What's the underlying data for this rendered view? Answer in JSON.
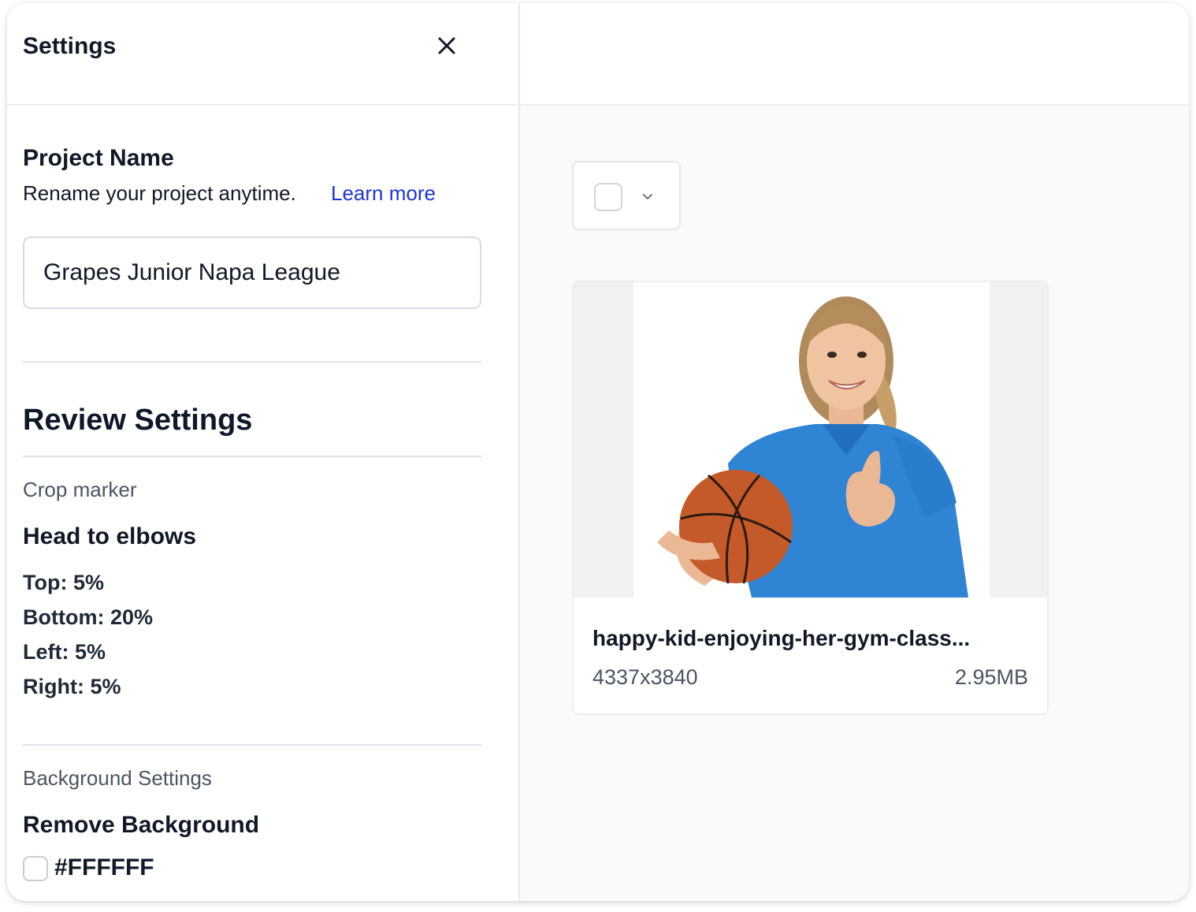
{
  "settings_panel": {
    "title": "Settings",
    "close_icon": "close-icon",
    "project_name": {
      "heading": "Project Name",
      "description": "Rename your project anytime.",
      "learn_more_label": "Learn more",
      "value": "Grapes Junior Napa League"
    },
    "review_settings": {
      "heading": "Review Settings",
      "crop_marker": {
        "caption": "Crop marker",
        "title": "Head to elbows",
        "lines": [
          "Top: 5%",
          "Bottom: 20%",
          "Left: 5%",
          "Right: 5%"
        ]
      },
      "background": {
        "caption": "Background Settings",
        "title": "Remove Background",
        "color_value": "#FFFFFF",
        "checked": false
      }
    }
  },
  "main": {
    "select_all": {
      "checked": false,
      "icon": "chevron-down-icon"
    },
    "files": [
      {
        "name": "happy-kid-enjoying-her-gym-class...",
        "dimensions": "4337x3840",
        "size": "2.95MB",
        "thumbnail": "girl-with-basketball-photo"
      }
    ]
  },
  "colors": {
    "link": "#1d35d6",
    "text_primary": "#111827",
    "text_secondary": "#4b5563",
    "panel_bg": "#f9fafb",
    "border": "#e5e7eb"
  }
}
